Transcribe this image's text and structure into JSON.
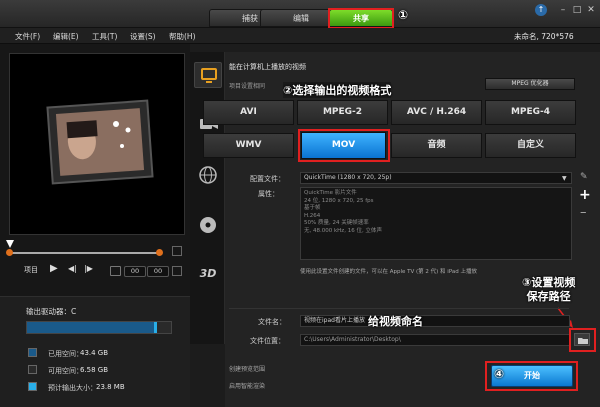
{
  "app": {
    "tabs": [
      {
        "label": "捕获"
      },
      {
        "label": "编辑"
      },
      {
        "label": "共享"
      }
    ],
    "project_info": "未命名, 720*576"
  },
  "menu": [
    "文件(F)",
    "编辑(E)",
    "工具(T)",
    "设置(S)",
    "帮助(H)"
  ],
  "player": {
    "project_label": "项目",
    "timecode": [
      "00",
      "00",
      "00",
      "00"
    ]
  },
  "output_drive": {
    "label": "输出驱动器：C",
    "used_label": "已用空间：",
    "used_value": "43.4 GB",
    "free_label": "可用空间：",
    "free_value": "6.58 GB",
    "est_label": "预计输出大小：",
    "est_value": "23.8 MB",
    "usage_fraction": 0.88,
    "colors": {
      "used": "#1a5a8a",
      "free": "#2a2a2a",
      "est": "#29aee8"
    }
  },
  "share": {
    "header": "能在计算机上播放的视频",
    "sub_header": "项目设置相同",
    "mpeg_opt_button": "MPEG 优化器",
    "formats_row1": [
      "AVI",
      "MPEG-2",
      "AVC / H.264",
      "MPEG-4"
    ],
    "formats_row2": [
      "WMV",
      "MOV",
      "音频",
      "自定义"
    ],
    "selected_format": "MOV",
    "config_label": "配置文件：",
    "config_value": "QuickTime (1280 x 720, 25p)",
    "props_label": "属性：",
    "props": [
      "QuickTime 影片文件",
      "24 位, 1280 x 720, 25 fps",
      "基于帧",
      "H.264",
      "50% 质量, 24 关键帧速率",
      "无, 48.000 kHz, 16 位, 立体声"
    ],
    "note": "使用此设置文件创建的文件，可以在 Apple TV (第 2 代) 和 iPad 上播放",
    "filename_label": "文件名：",
    "filename_value": "视频在ipad看片上播放",
    "location_label": "文件位置：",
    "location_value": "C:\\Users\\Administrator\\Desktop\\",
    "check1": "创建预览范围",
    "check2": "启用智能渲染",
    "start_button": "开始"
  },
  "annotations": {
    "a1": "①",
    "a2": "②选择输出的视频格式",
    "a3_line1": "③设置视频",
    "a3_line2": "保存路径",
    "a4": "④",
    "a_name": "给视频命名"
  },
  "icons": {
    "sidebar": [
      "monitor-icon",
      "camcorder-icon",
      "globe-icon",
      "disc-icon",
      "3d-icon"
    ],
    "accent": "#29aee8",
    "brand_green": "#5cbf1f"
  }
}
